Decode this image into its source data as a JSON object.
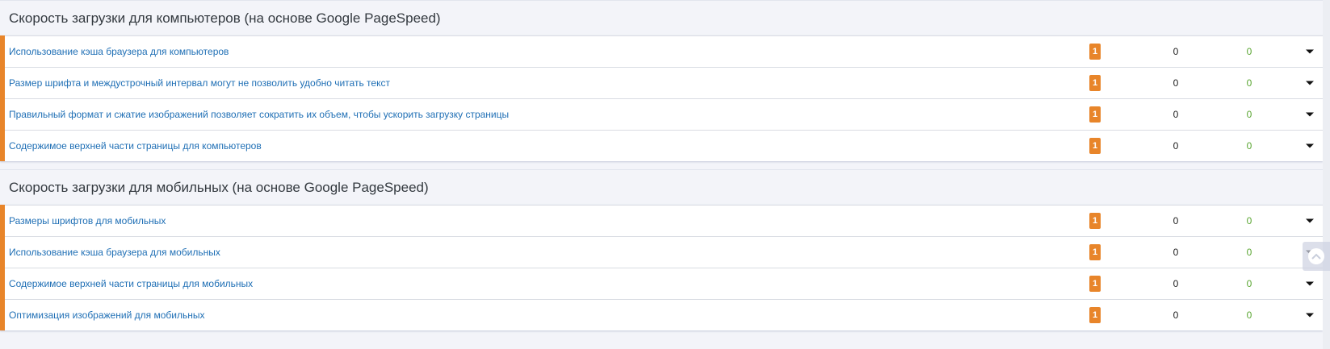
{
  "sections": [
    {
      "title": "Скорость загрузки для компьютеров (на основе Google PageSpeed)",
      "rows": [
        {
          "label": "Использование кэша браузера для компьютеров",
          "badge": "1",
          "neutral": "0",
          "ok": "0"
        },
        {
          "label": "Размер шрифта и междустрочный интервал могут не позволить удобно читать текст",
          "badge": "1",
          "neutral": "0",
          "ok": "0"
        },
        {
          "label": "Правильный формат и сжатие изображений позволяет сократить их объем, чтобы ускорить загрузку страницы",
          "badge": "1",
          "neutral": "0",
          "ok": "0"
        },
        {
          "label": "Содержимое верхней части страницы для компьютеров",
          "badge": "1",
          "neutral": "0",
          "ok": "0"
        }
      ]
    },
    {
      "title": "Скорость загрузки для мобильных (на основе Google PageSpeed)",
      "rows": [
        {
          "label": "Размеры шрифтов для мобильных",
          "badge": "1",
          "neutral": "0",
          "ok": "0"
        },
        {
          "label": "Использование кэша браузера для мобильных",
          "badge": "1",
          "neutral": "0",
          "ok": "0"
        },
        {
          "label": "Содержимое верхней части страницы для мобильных",
          "badge": "1",
          "neutral": "0",
          "ok": "0"
        },
        {
          "label": "Оптимизация изображений для мобильных",
          "badge": "1",
          "neutral": "0",
          "ok": "0"
        }
      ]
    }
  ],
  "colors": {
    "accent": "#e8852a",
    "link": "#1f6fb5",
    "ok": "#5aa632",
    "header_bg": "#f3f4f9"
  },
  "icons": {
    "expand": "chevron-down-icon",
    "scroll_top": "arrow-up-icon"
  }
}
